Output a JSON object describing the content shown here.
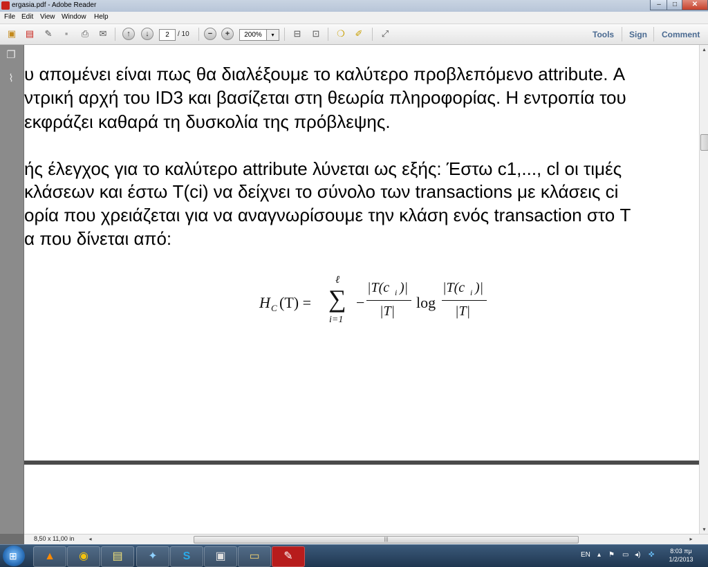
{
  "window": {
    "title": "ergasia.pdf - Adobe Reader",
    "controls": {
      "minimize": "–",
      "maximize": "□",
      "close": "✕"
    }
  },
  "menu": [
    "File",
    "Edit",
    "View",
    "Window",
    "Help"
  ],
  "toolbar": {
    "page_current": "2",
    "page_total": "/ 10",
    "zoom": "200%",
    "zoom_dropdown": "▾",
    "icons": [
      "open-icon",
      "create-pdf-icon",
      "edit-icon",
      "save-icon",
      "print-icon",
      "email-icon",
      "prev-page-icon",
      "next-page-icon",
      "zoom-out-icon",
      "zoom-in-icon",
      "fit-page-icon",
      "fit-width-icon",
      "comment-icon",
      "highlight-icon",
      "fullscreen-icon"
    ],
    "links": [
      "Tools",
      "Sign",
      "Comment"
    ]
  },
  "nav_panel": {
    "icons": [
      "pages-icon",
      "attachment-icon"
    ]
  },
  "document": {
    "lines": [
      "υ απομένει είναι πως θα διαλέξουμε το καλύτερο προβλεπόμενο attribute. Α",
      "ντρική αρχή του ID3 και βασίζεται στη θεωρία πληροφορίας. Η εντροπία του",
      "εκφράζει καθαρά τη δυσκολία της πρόβλεψης.",
      "ής έλεγχος  για το καλύτερο attribute λύνεται ως εξής: Έστω c1,..., cl οι τιμές",
      " κλάσεων και έστω T(ci) να δείχνει το σύνολο των transactions με κλάσεις ci",
      "ορία που χρειάζεται για να αναγνωρίσουμε την κλάση ενός transaction στο T",
      "α που δίνεται από:"
    ],
    "formula": {
      "lhs": "H",
      "lhs_sub": "C",
      "lhs_arg": "(T) =",
      "sum": "∑",
      "sum_top": "ℓ",
      "sum_bottom": "i=1",
      "minus": "−",
      "frac1_num": "|T(c",
      "frac1_num_sub": "i",
      "frac1_num_end": ")|",
      "frac1_den": "|T|",
      "log": "log",
      "frac2_num": "|T(c",
      "frac2_num_sub": "i",
      "frac2_num_end": ")|",
      "frac2_den": "|T|"
    }
  },
  "status": {
    "page_size": "8,50 x 11,00 in",
    "left_arrow": "◂",
    "right_arrow": "▸",
    "grip": "|||"
  },
  "scrollbar": {
    "up": "▴",
    "down": "▾"
  },
  "taskbar": {
    "start": "⊞",
    "apps": [
      "vlc-icon",
      "chrome-icon",
      "sticky-notes-icon",
      "network-app-icon",
      "skype-icon",
      "pdf-creator-icon",
      "file-explorer-icon",
      "adobe-reader-icon"
    ],
    "app_glyphs": [
      "▲",
      "◉",
      "▤",
      "✦",
      "S",
      "▣",
      "▭",
      "✎"
    ],
    "language": "EN",
    "tray_up": "▴",
    "tray_icons": [
      "flag-icon",
      "network-icon",
      "volume-icon",
      "dropbox-icon"
    ],
    "tray_glyphs": [
      "⚑",
      "▭",
      "◂)",
      "✜"
    ],
    "time": "8:03 πμ",
    "date": "1/2/2013"
  }
}
